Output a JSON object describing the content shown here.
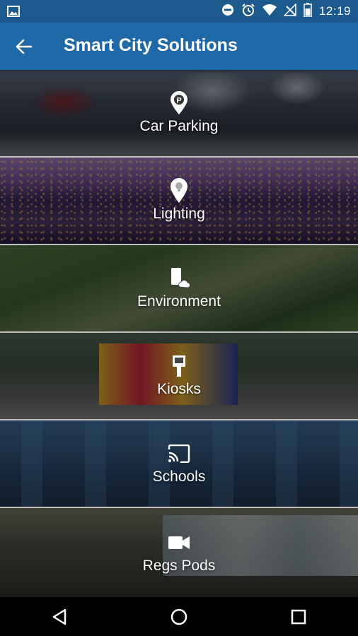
{
  "status_bar": {
    "time": "12:19",
    "icons": [
      "image-icon",
      "do-not-disturb-icon",
      "alarm-icon",
      "wifi-icon",
      "no-signal-icon",
      "battery-icon"
    ]
  },
  "app_bar": {
    "title": "Smart City Solutions",
    "back_icon": "arrow-left-icon"
  },
  "tiles": [
    {
      "label": "Car Parking",
      "icon": "parking-pin-icon"
    },
    {
      "label": "Lighting",
      "icon": "bulb-pin-icon"
    },
    {
      "label": "Environment",
      "icon": "phone-cloud-icon"
    },
    {
      "label": "Kiosks",
      "icon": "kiosk-icon"
    },
    {
      "label": "Schools",
      "icon": "cast-icon"
    },
    {
      "label": "Regs Pods",
      "icon": "video-camera-icon"
    }
  ],
  "nav_bar": {
    "icons": [
      "back-triangle-icon",
      "home-circle-icon",
      "recents-square-icon"
    ]
  }
}
